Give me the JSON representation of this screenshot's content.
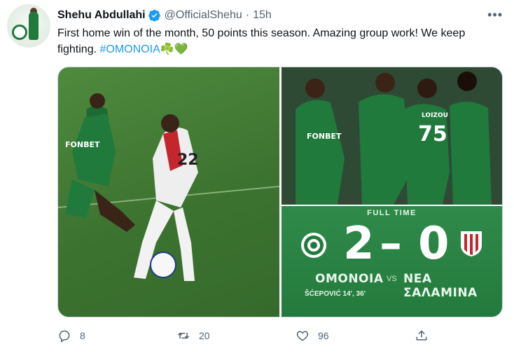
{
  "author": {
    "name": "Shehu Abdullahi",
    "handle": "@OfficialShehu",
    "time": "15h",
    "separator": "·"
  },
  "tweet": {
    "text_main": "First home win of the month, 50 points this season. Amazing group work! We keep fighting.",
    "hashtag": "#OMONOIA",
    "emoji": "☘️💚"
  },
  "scorecard": {
    "full_time_label": "FULL TIME",
    "home_score": "2",
    "dash": "–",
    "away_score": "0",
    "home_team": "ΟΜΟΝΟΙΑ",
    "vs": "VS",
    "away_team": "ΝΕΑ ΣΑΛΑΜΙΝΑ",
    "scorer": "ŠĆEPOVIĆ 14', 36'"
  },
  "photos": {
    "sponsor": "FONBET",
    "jersey_number_left": "22",
    "jersey_number_right": "75",
    "jersey_name_right": "LOIZOU"
  },
  "actions": {
    "replies": "8",
    "retweets": "20",
    "likes": "96"
  },
  "icons": {
    "verified": "verified-badge-icon",
    "more": "more-options-icon",
    "reply": "reply-icon",
    "retweet": "retweet-icon",
    "like": "heart-icon",
    "share": "share-icon"
  },
  "colors": {
    "verified_blue": "#1d9bf0",
    "hashtag": "#1d9bf0",
    "muted": "#536471",
    "omonoia_green": "#237a3c"
  }
}
